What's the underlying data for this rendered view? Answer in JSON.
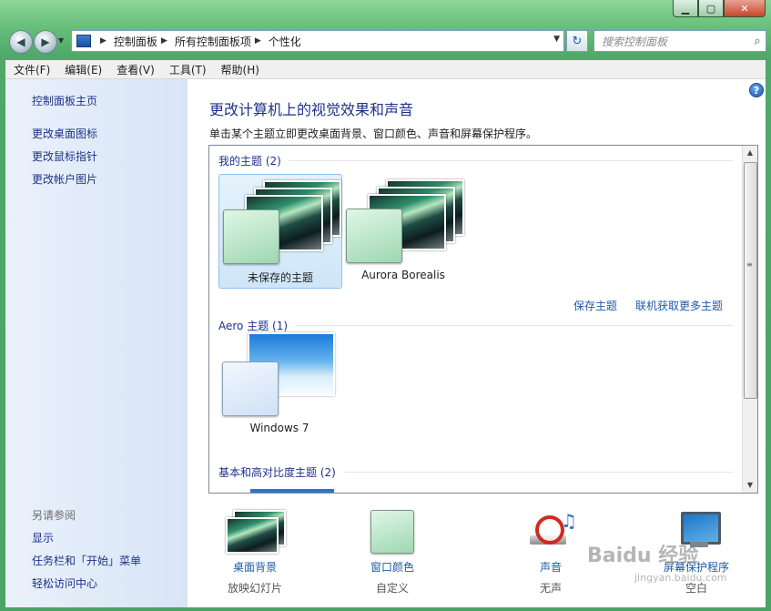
{
  "window": {
    "min_label": "▁",
    "max_label": "▢",
    "close_label": "✕"
  },
  "address": {
    "crumbs": [
      "控制面板",
      "所有控制面板项",
      "个性化"
    ]
  },
  "search": {
    "placeholder": "搜索控制面板"
  },
  "menu": [
    "文件(F)",
    "编辑(E)",
    "查看(V)",
    "工具(T)",
    "帮助(H)"
  ],
  "sidebar": {
    "home": "控制面板主页",
    "links": [
      "更改桌面图标",
      "更改鼠标指针",
      "更改帐户图片"
    ],
    "see_also": "另请参阅",
    "see_links": [
      "显示",
      "任务栏和「开始」菜单",
      "轻松访问中心"
    ]
  },
  "main": {
    "title": "更改计算机上的视觉效果和声音",
    "subtitle": "单击某个主题立即更改桌面背景、窗口颜色、声音和屏幕保护程序。",
    "my_themes": {
      "header": "我的主题 (2)",
      "items": [
        "未保存的主题",
        "Aurora Borealis"
      ],
      "save": "保存主题",
      "more": "联机获取更多主题"
    },
    "aero_themes": {
      "header": "Aero 主题 (1)",
      "items": [
        "Windows 7"
      ]
    },
    "basic_themes": {
      "header": "基本和高对比度主题 (2)"
    }
  },
  "bottom": [
    {
      "label": "桌面背景",
      "sub": "放映幻灯片"
    },
    {
      "label": "窗口颜色",
      "sub": "自定义"
    },
    {
      "label": "声音",
      "sub": "无声"
    },
    {
      "label": "屏幕保护程序",
      "sub": "空白"
    }
  ],
  "watermark": {
    "main": "Baidu 经验",
    "url": "jingyan.baidu.com"
  }
}
